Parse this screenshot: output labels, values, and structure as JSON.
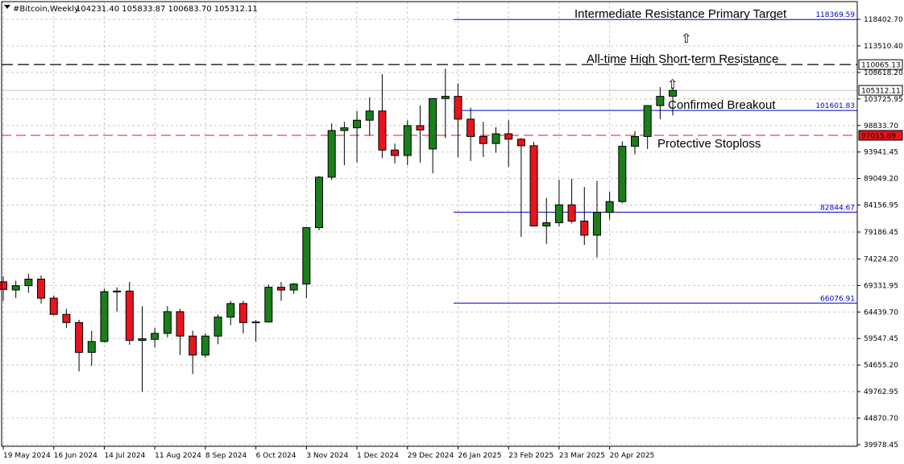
{
  "chart_data": {
    "type": "candlestick",
    "header": {
      "symbol": "#Bitcoin,Weekly",
      "ohlc": "104231.40 105833.87 100683.70 105312.11"
    },
    "y_ticks": [
      "118402.70",
      "113510.40",
      "108618.20",
      "103725.95",
      "98833.70",
      "93941.45",
      "89049.20",
      "84156.95",
      "79186.45",
      "74224.20",
      "69331.95",
      "64439.70",
      "59547.45",
      "54655.20",
      "49762.95",
      "44870.70",
      "39978.45"
    ],
    "x_labels": [
      "19 May 2024",
      "16 Jun 2024",
      "14 Jul 2024",
      "11 Aug 2024",
      "8 Sep 2024",
      "6 Oct 2024",
      "3 Nov 2024",
      "1 Dec 2024",
      "29 Dec 2024",
      "26 Jan 2025",
      "23 Feb 2025",
      "23 Mar 2025",
      "20 Apr 2025"
    ],
    "ylim": [
      39978.45,
      120400
    ],
    "grid": true,
    "candles": [
      [
        70000,
        71000,
        66500,
        68600
      ],
      [
        68500,
        70200,
        67000,
        69300
      ],
      [
        69300,
        71500,
        68000,
        70500
      ],
      [
        70500,
        71200,
        66000,
        67000
      ],
      [
        67000,
        67500,
        63800,
        64000
      ],
      [
        64000,
        65000,
        61500,
        62500
      ],
      [
        62500,
        63000,
        53500,
        57000
      ],
      [
        57000,
        61000,
        54500,
        59000
      ],
      [
        59000,
        68700,
        58800,
        68200
      ],
      [
        68200,
        69000,
        64500,
        68300
      ],
      [
        68300,
        70000,
        58400,
        59200
      ],
      [
        59200,
        65500,
        49700,
        59500
      ],
      [
        59400,
        61500,
        57900,
        60500
      ],
      [
        60500,
        65500,
        59800,
        64500
      ],
      [
        64500,
        65000,
        56500,
        60000
      ],
      [
        60000,
        61000,
        53000,
        56500
      ],
      [
        56500,
        60500,
        56000,
        60000
      ],
      [
        60000,
        64000,
        58500,
        63500
      ],
      [
        63500,
        66500,
        62000,
        66000
      ],
      [
        66000,
        66500,
        60500,
        62500
      ],
      [
        62500,
        63000,
        59000,
        62600
      ],
      [
        62600,
        69500,
        62500,
        69000
      ],
      [
        69000,
        70000,
        66500,
        68500
      ],
      [
        68500,
        69800,
        67800,
        69600
      ],
      [
        69600,
        76000,
        67000,
        80000
      ],
      [
        80000,
        89500,
        79500,
        89300
      ],
      [
        89300,
        99200,
        88800,
        97900
      ],
      [
        97900,
        99500,
        91500,
        98400
      ],
      [
        98400,
        101500,
        92000,
        99800
      ],
      [
        99800,
        104000,
        97000,
        101500
      ],
      [
        101500,
        108300,
        92800,
        94300
      ],
      [
        94300,
        95500,
        91800,
        93300
      ],
      [
        93300,
        99800,
        91500,
        98800
      ],
      [
        98800,
        102500,
        92000,
        98000
      ],
      [
        94500,
        102500,
        90000,
        103800
      ],
      [
        103800,
        109300,
        96500,
        104200
      ],
      [
        104200,
        106600,
        93000,
        100000
      ],
      [
        100000,
        102100,
        92300,
        96800
      ],
      [
        96800,
        99500,
        93000,
        95500
      ],
      [
        95500,
        98500,
        93800,
        97300
      ],
      [
        97300,
        99800,
        91200,
        96300
      ],
      [
        96300,
        96500,
        78300,
        95100
      ],
      [
        95100,
        95800,
        80500,
        80300
      ],
      [
        80300,
        85500,
        77000,
        80900
      ],
      [
        80900,
        88800,
        80200,
        84200
      ],
      [
        84200,
        89000,
        80800,
        81200
      ],
      [
        81200,
        87500,
        76800,
        78600
      ],
      [
        78600,
        88600,
        74500,
        82800
      ],
      [
        82800,
        86600,
        81500,
        84800
      ],
      [
        84800,
        95900,
        84500,
        95000
      ],
      [
        95000,
        97800,
        93500,
        96800
      ],
      [
        96800,
        99500,
        94500,
        102500
      ],
      [
        102500,
        105900,
        100000,
        104200
      ],
      [
        104231.4,
        105833.87,
        100683.7,
        105312.11
      ]
    ],
    "levels": [
      {
        "value": "118369.59",
        "kind": "blue"
      },
      {
        "value": "110065.13",
        "kind": "dashed-black",
        "tag": true
      },
      {
        "value": "105312.11",
        "kind": "current",
        "tag": true
      },
      {
        "value": "101601.83",
        "kind": "blue"
      },
      {
        "value": "97015.89",
        "kind": "dashed-red",
        "tag": true
      },
      {
        "value": "82844.67",
        "kind": "blue"
      },
      {
        "value": "66076.91",
        "kind": "blue"
      }
    ],
    "annotations": [
      {
        "text": "Intermediate Resistance Primary Target"
      },
      {
        "text": "All-time High Short-term Resistance"
      },
      {
        "text": "Confirmed Breakout"
      },
      {
        "text": "Protective Stoploss"
      }
    ],
    "colors": {
      "bull": "#1a7f1a",
      "bear": "#e8141d",
      "blue_level": "#0000cc",
      "stop_line": "#e8141d",
      "ath_line": "#000000",
      "grid": "#c8c8c8"
    }
  }
}
